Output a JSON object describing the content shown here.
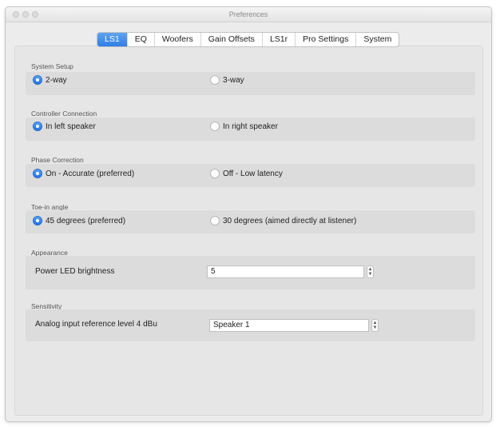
{
  "window": {
    "title": "Preferences"
  },
  "tabs": [
    {
      "label": "LS1",
      "active": true
    },
    {
      "label": "EQ",
      "active": false
    },
    {
      "label": "Woofers",
      "active": false
    },
    {
      "label": "Gain Offsets",
      "active": false
    },
    {
      "label": "LS1r",
      "active": false
    },
    {
      "label": "Pro Settings",
      "active": false
    },
    {
      "label": "System",
      "active": false
    }
  ],
  "sections": {
    "system_setup": {
      "title": "System Setup",
      "options": [
        {
          "label": "2-way",
          "selected": true
        },
        {
          "label": "3-way",
          "selected": false
        }
      ]
    },
    "controller_connection": {
      "title": "Controller Connection",
      "options": [
        {
          "label": "In left speaker",
          "selected": true
        },
        {
          "label": "In right speaker",
          "selected": false
        }
      ]
    },
    "phase_correction": {
      "title": "Phase Correction",
      "options": [
        {
          "label": "On - Accurate (preferred)",
          "selected": true
        },
        {
          "label": "Off - Low latency",
          "selected": false
        }
      ]
    },
    "toe_in": {
      "title": "Toe-in angle",
      "options": [
        {
          "label": "45 degrees (preferred)",
          "selected": true
        },
        {
          "label": "30 degrees (aimed directly at listener)",
          "selected": false
        }
      ]
    },
    "appearance": {
      "title": "Appearance",
      "label": "Power LED brightness",
      "value": "5"
    },
    "sensitivity": {
      "title": "Sensitivity",
      "label": "Analog input reference level 4 dBu",
      "value": "Speaker 1"
    }
  },
  "colors": {
    "accent": "#2f7ee6",
    "group_bg": "#dcdcdc",
    "window_bg": "#ececec"
  },
  "icons": {
    "stepper": "stepper-arrows-icon"
  }
}
